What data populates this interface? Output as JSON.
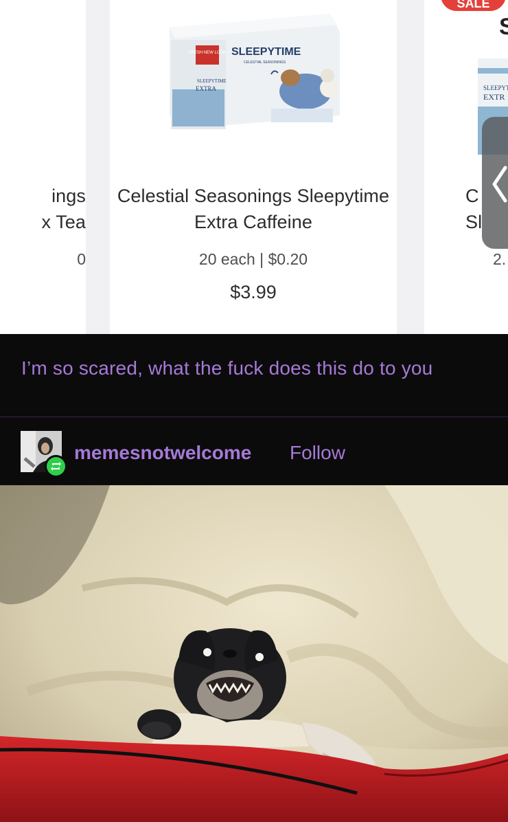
{
  "shop": {
    "left_product": {
      "title": "ings\nx Tea",
      "unit": "0"
    },
    "main_product": {
      "title": "Celestial Seasonings Sleepytime Extra Caffeine",
      "unit": "20 each  | $0.20",
      "price": "$3.99",
      "box_text": {
        "brand": "SLEEPYTIME",
        "sub": "CELESTIAL SEASONINGS",
        "badge": "FRESH NEW LOOK",
        "left_label": "SLEEPYTIME",
        "extra": "EXTRA"
      }
    },
    "right_product": {
      "title": "C\nSl",
      "unit": "2.",
      "box_text": "SLEEPYT\nEXTR"
    },
    "sale_badge": "SALE",
    "s_fragment": "S",
    "drawer_tab_icon": "chevron-left-icon"
  },
  "post": {
    "text": "I’m so scared, what the fuck does this do to you",
    "username": "memesnotwelcome",
    "follow_label": "Follow",
    "reblog_icon": "reblog-icon",
    "accent_color": "#a679d8",
    "reblog_color": "#2fcf4a"
  }
}
